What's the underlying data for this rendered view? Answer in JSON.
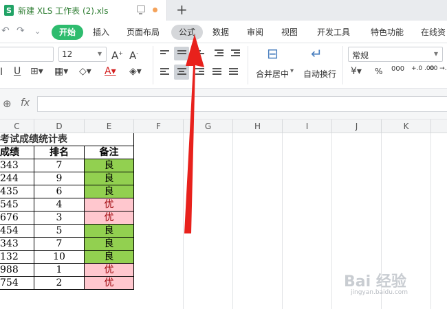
{
  "titlebar": {
    "app_icon": "S",
    "tab_title": "新建 XLS 工作表 (2).xls",
    "new_tab": "+"
  },
  "menu": {
    "items": [
      "开始",
      "插入",
      "页面布局",
      "公式",
      "数据",
      "审阅",
      "视图",
      "开发工具",
      "特色功能",
      "在线资"
    ]
  },
  "ribbon": {
    "font_size": "12",
    "number_format": "常规",
    "merge_center": "合并居中",
    "wrap_text": "自动换行",
    "percent": "%",
    "thousands": "000",
    "dec_inc": "+.0 .00",
    "dec_dec": ".00 →.0"
  },
  "formula_bar": {
    "fx_label": "fx"
  },
  "columns": [
    "C",
    "D",
    "E",
    "F",
    "G",
    "H",
    "I",
    "J",
    "K"
  ],
  "sheet": {
    "title": "考试成绩统计表",
    "headers": {
      "c": "成绩",
      "d": "排名",
      "e": "备注"
    },
    "rows": [
      {
        "c": "343",
        "d": "7",
        "e": "良",
        "level": "good"
      },
      {
        "c": "244",
        "d": "9",
        "e": "良",
        "level": "good"
      },
      {
        "c": "435",
        "d": "6",
        "e": "良",
        "level": "good"
      },
      {
        "c": "545",
        "d": "4",
        "e": "优",
        "level": "excellent"
      },
      {
        "c": "676",
        "d": "3",
        "e": "优",
        "level": "excellent"
      },
      {
        "c": "454",
        "d": "5",
        "e": "良",
        "level": "good"
      },
      {
        "c": "343",
        "d": "7",
        "e": "良",
        "level": "good"
      },
      {
        "c": "132",
        "d": "10",
        "e": "良",
        "level": "good"
      },
      {
        "c": "988",
        "d": "1",
        "e": "优",
        "level": "excellent"
      },
      {
        "c": "754",
        "d": "2",
        "e": "优",
        "level": "excellent"
      }
    ]
  },
  "colors": {
    "good_fill": "#92d050",
    "excellent_fill": "#ffc7ce",
    "excellent_text": "#9c0006",
    "accent": "#2ebc6e",
    "arrow": "#e8211c"
  },
  "watermark": {
    "main": "Bai 经验",
    "sub": "jingyan.baidu.com"
  }
}
